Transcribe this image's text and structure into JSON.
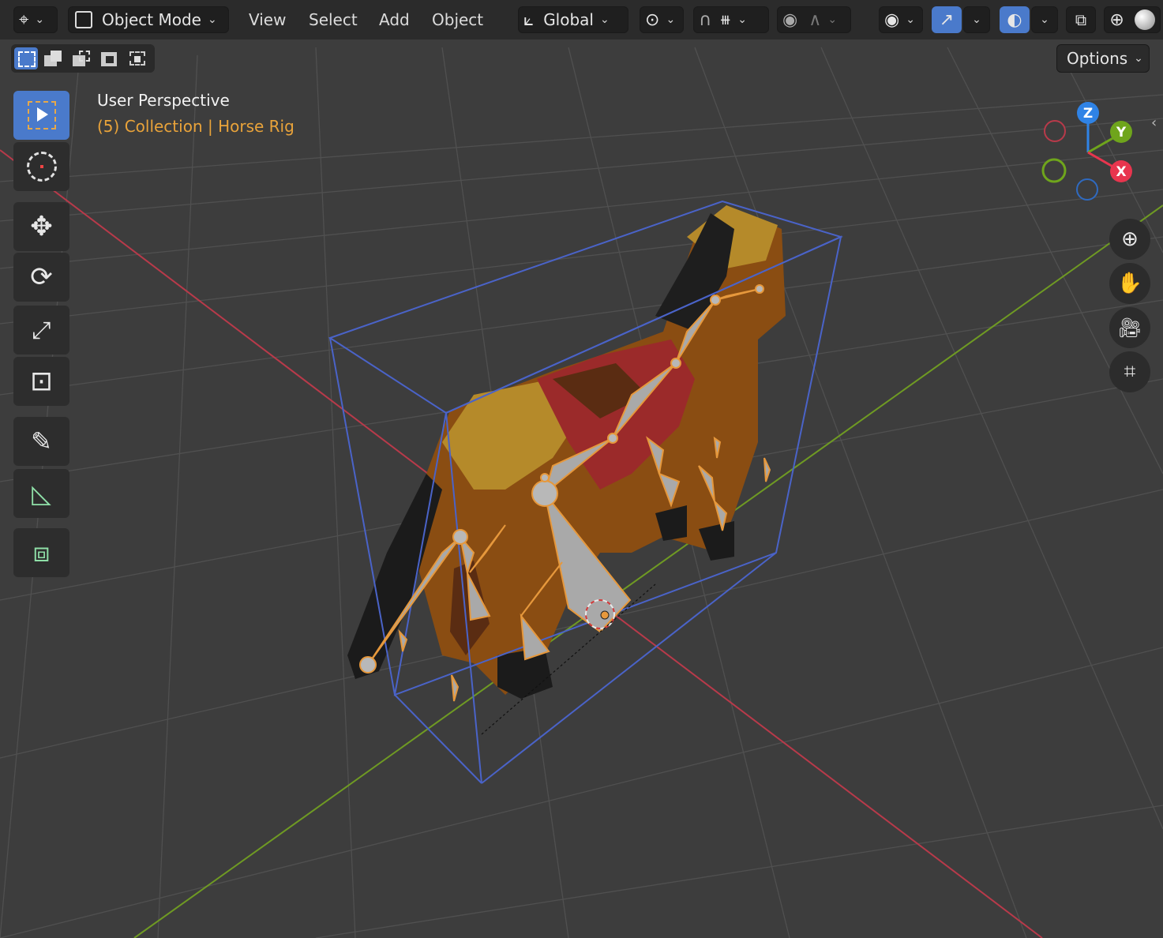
{
  "header": {
    "editor_type_icon": "editor-type-icon",
    "mode_label": "Object Mode",
    "menus": [
      "View",
      "Select",
      "Add",
      "Object"
    ],
    "transform_orientation": "Global",
    "options_label": "Options"
  },
  "viewport_overlay": {
    "view_name": "User Perspective",
    "collection_info": "(5) Collection | Horse Rig"
  },
  "gizmo": {
    "z_label": "Z",
    "y_label": "Y",
    "x_label": "X"
  },
  "toolbar": {
    "tools": [
      "select-box-icon",
      "cursor-icon",
      "move-icon",
      "rotate-icon",
      "scale-icon",
      "transform-icon",
      "annotate-icon",
      "measure-icon",
      "add-cube-icon"
    ]
  },
  "colors": {
    "accent": "#4a7acb",
    "axis_x": "#e8354e",
    "axis_y": "#6fa51c",
    "axis_z": "#2f83e6",
    "selection": "#e6983c",
    "grid_bg": "#3d3d3d"
  }
}
